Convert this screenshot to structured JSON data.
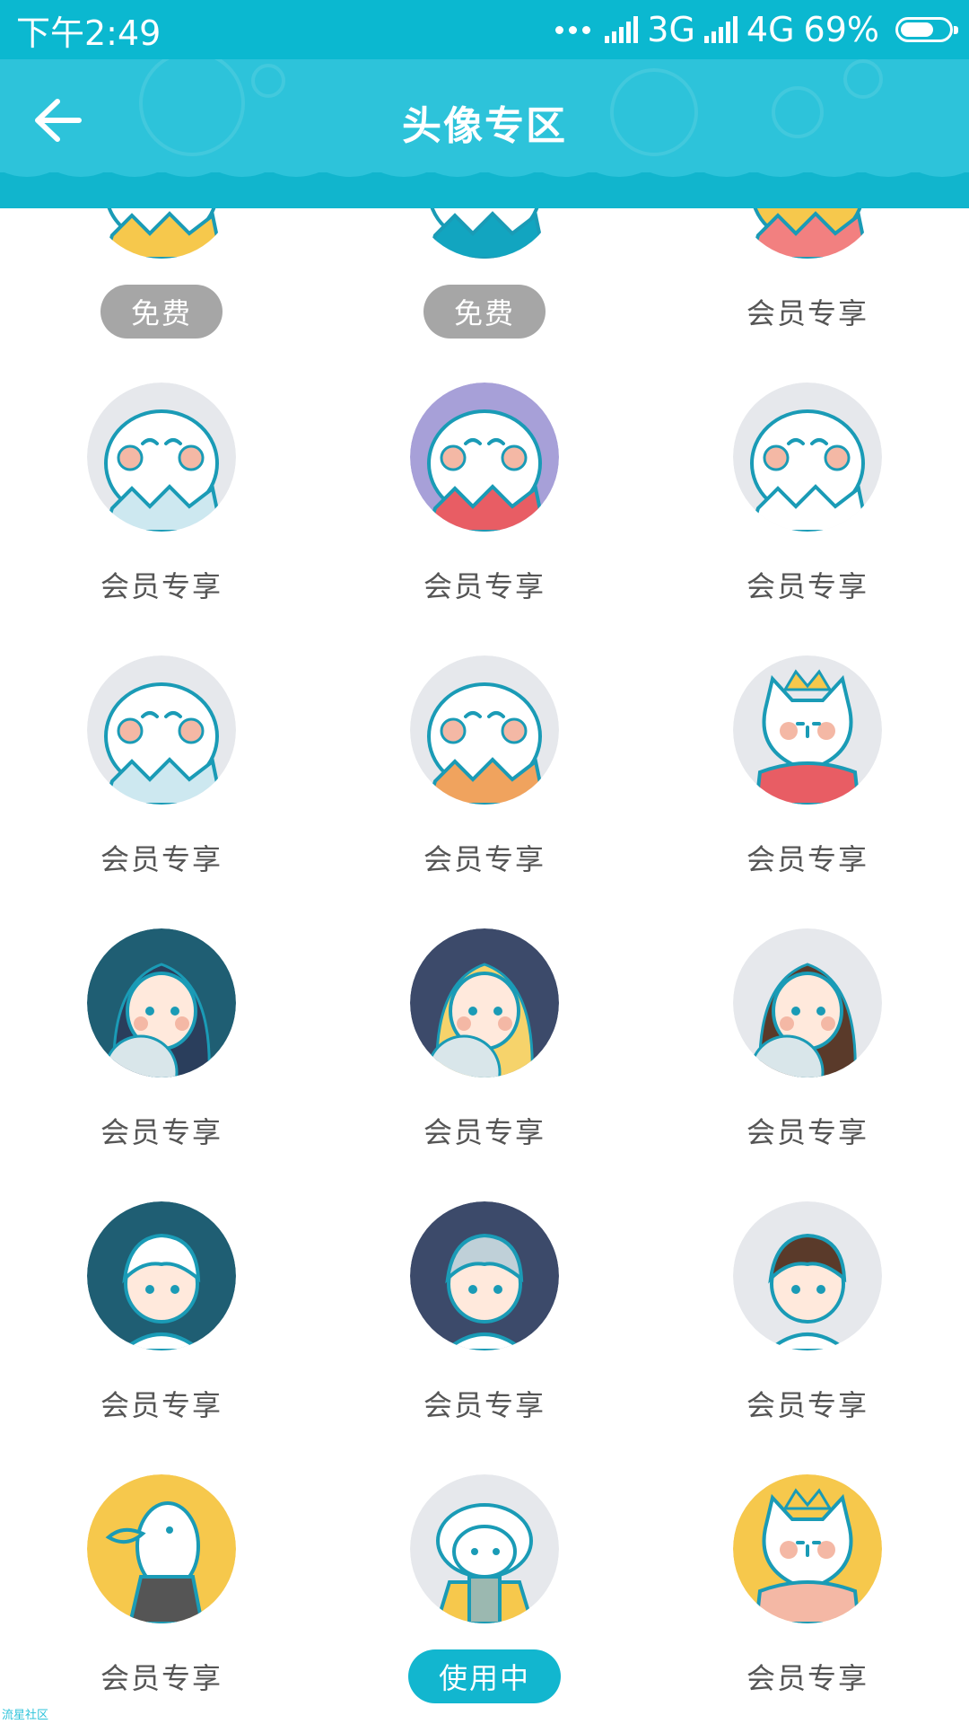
{
  "status_bar": {
    "time": "下午2:49",
    "net1": "3G",
    "net2": "4G",
    "battery": "69%",
    "battery_level": 0.69
  },
  "header": {
    "title": "头像专区",
    "back_icon": "arrow-left-icon"
  },
  "avatars": [
    {
      "label": "免费",
      "style": "free"
    },
    {
      "label": "免费",
      "style": "free"
    },
    {
      "label": "会员专享",
      "style": "member"
    },
    {
      "label": "会员专享",
      "style": "member"
    },
    {
      "label": "会员专享",
      "style": "member"
    },
    {
      "label": "会员专享",
      "style": "member"
    },
    {
      "label": "会员专享",
      "style": "member"
    },
    {
      "label": "会员专享",
      "style": "member"
    },
    {
      "label": "会员专享",
      "style": "member"
    },
    {
      "label": "会员专享",
      "style": "member"
    },
    {
      "label": "会员专享",
      "style": "member"
    },
    {
      "label": "会员专享",
      "style": "member"
    },
    {
      "label": "会员专享",
      "style": "member"
    },
    {
      "label": "会员专享",
      "style": "member"
    },
    {
      "label": "会员专享",
      "style": "member"
    },
    {
      "label": "会员专享",
      "style": "member"
    },
    {
      "label": "使用中",
      "style": "inuse"
    },
    {
      "label": "会员专享",
      "style": "member"
    }
  ],
  "watermark": "流星社区",
  "colors": {
    "accent": "#12B6CF",
    "free_pill": "#A6A6A6"
  }
}
